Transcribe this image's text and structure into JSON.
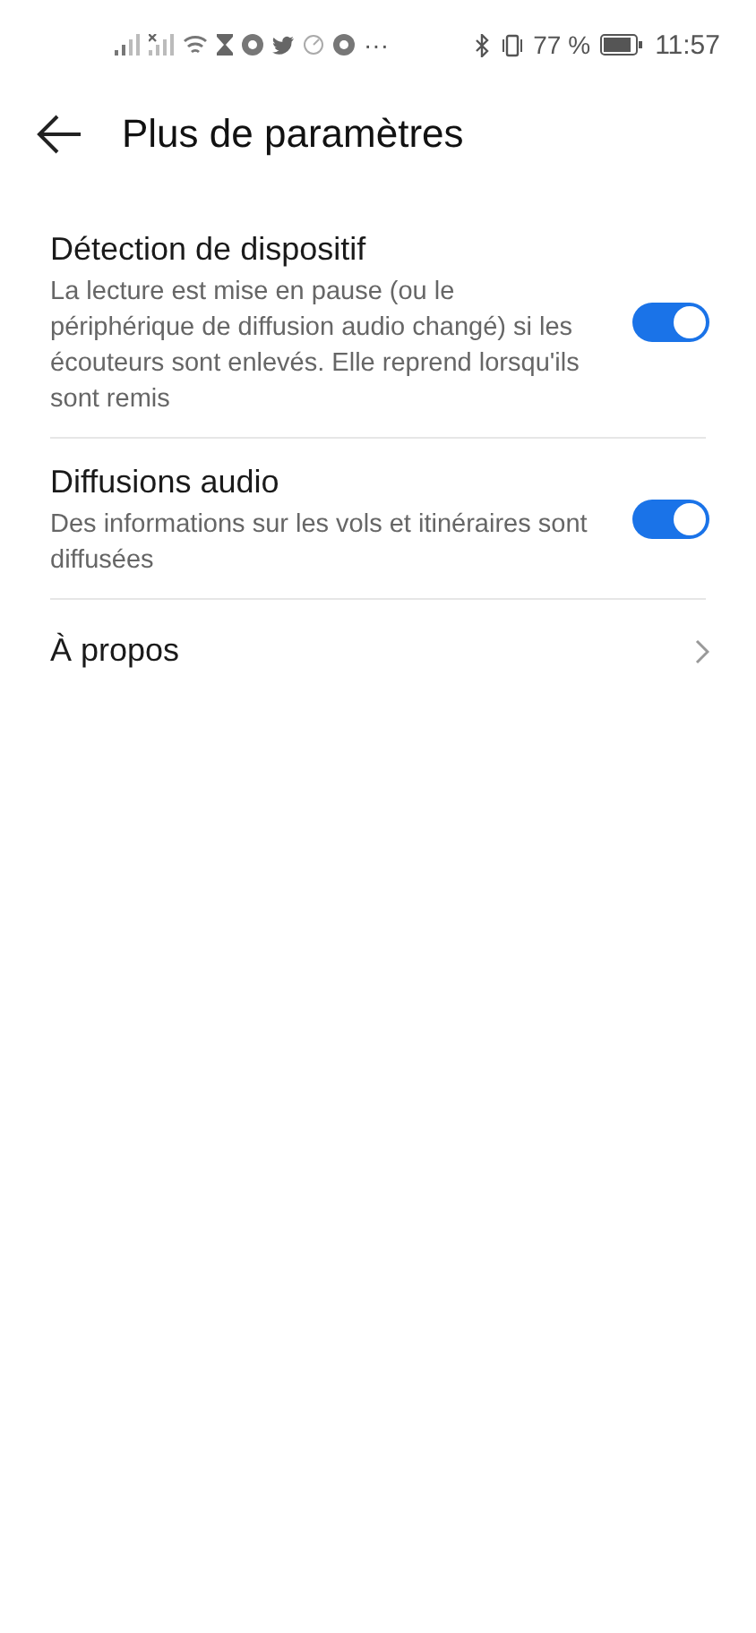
{
  "status_bar": {
    "more": "···",
    "battery_percent": "77 %",
    "time": "11:57"
  },
  "header": {
    "title": "Plus de paramètres"
  },
  "rows": [
    {
      "kind": "toggle",
      "title": "Détection de dispositif",
      "description": "La lecture est mise en pause (ou le périphérique de diffusion audio changé) si les écouteurs sont enlevés. Elle reprend lorsqu'ils sont remis",
      "on": true
    },
    {
      "kind": "toggle",
      "title": "Diffusions audio",
      "description": "Des informations sur les vols et itinéraires sont diffusées",
      "on": true
    },
    {
      "kind": "link",
      "title": "À propos"
    }
  ]
}
